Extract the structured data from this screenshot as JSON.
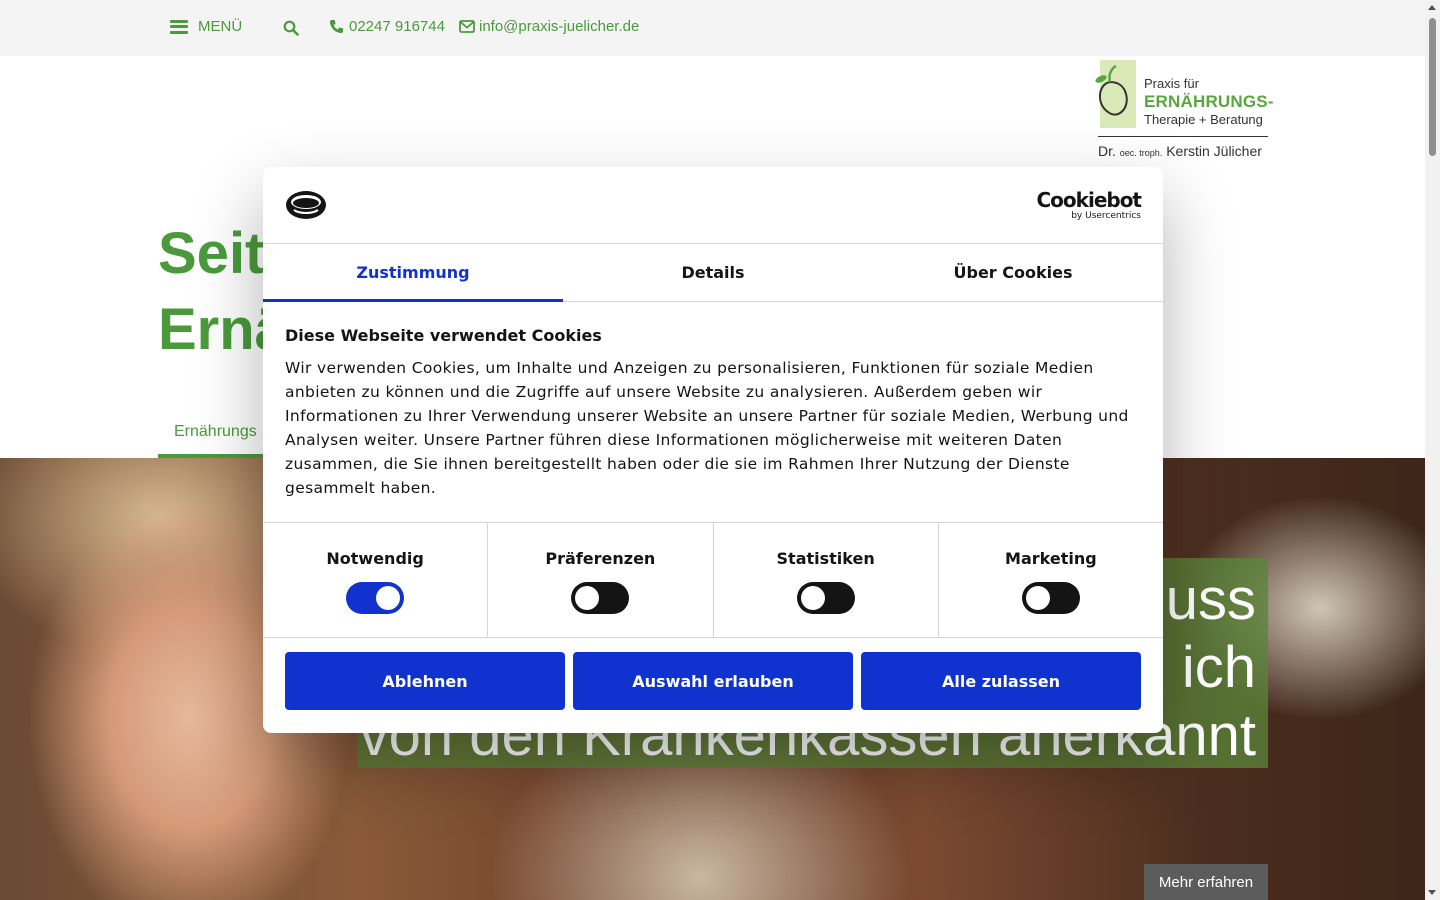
{
  "topbar": {
    "menu_label": "MENÜ",
    "phone": "02247 916744",
    "email": "info@praxis-juelicher.de"
  },
  "logo": {
    "line1": "Praxis für",
    "line2": "ERNÄHRUNGS-",
    "line3": "Therapie + Beratung",
    "line4_prefix": "Dr.",
    "line4_small": "oec. troph.",
    "line4_name": "Kerstin Jülicher"
  },
  "page": {
    "headline_line1": "Seit",
    "headline_line2": "Ernä",
    "tab_label": "Ernährungs",
    "hero_line1": "uss",
    "hero_line2": "ich",
    "hero_line3": "von den Krankenkassen anerkannt",
    "more_button": "Mehr erfahren"
  },
  "cookie_dialog": {
    "brand": "Cookiebot",
    "brand_sub": "by Usercentrics",
    "tabs": [
      {
        "label": "Zustimmung",
        "active": true
      },
      {
        "label": "Details",
        "active": false
      },
      {
        "label": "Über Cookies",
        "active": false
      }
    ],
    "title": "Diese Webseite verwendet Cookies",
    "text": "Wir verwenden Cookies, um Inhalte und Anzeigen zu personalisieren, Funktionen für soziale Medien anbieten zu können und die Zugriffe auf unsere Website zu analysieren. Außerdem geben wir Informationen zu Ihrer Verwendung unserer Website an unsere Partner für soziale Medien, Werbung und Analysen weiter. Unsere Partner führen diese Informationen möglicherweise mit weiteren Daten zusammen, die Sie ihnen bereitgestellt haben oder die sie im Rahmen Ihrer Nutzung der Dienste gesammelt haben.",
    "toggles": [
      {
        "label": "Notwendig",
        "on": true
      },
      {
        "label": "Präferenzen",
        "on": false
      },
      {
        "label": "Statistiken",
        "on": false
      },
      {
        "label": "Marketing",
        "on": false
      }
    ],
    "buttons": {
      "decline": "Ablehnen",
      "allow_selection": "Auswahl erlauben",
      "allow_all": "Alle zulassen"
    }
  },
  "colors": {
    "brand_green": "#4a9a3c",
    "cookiebot_blue": "#1032cf"
  }
}
